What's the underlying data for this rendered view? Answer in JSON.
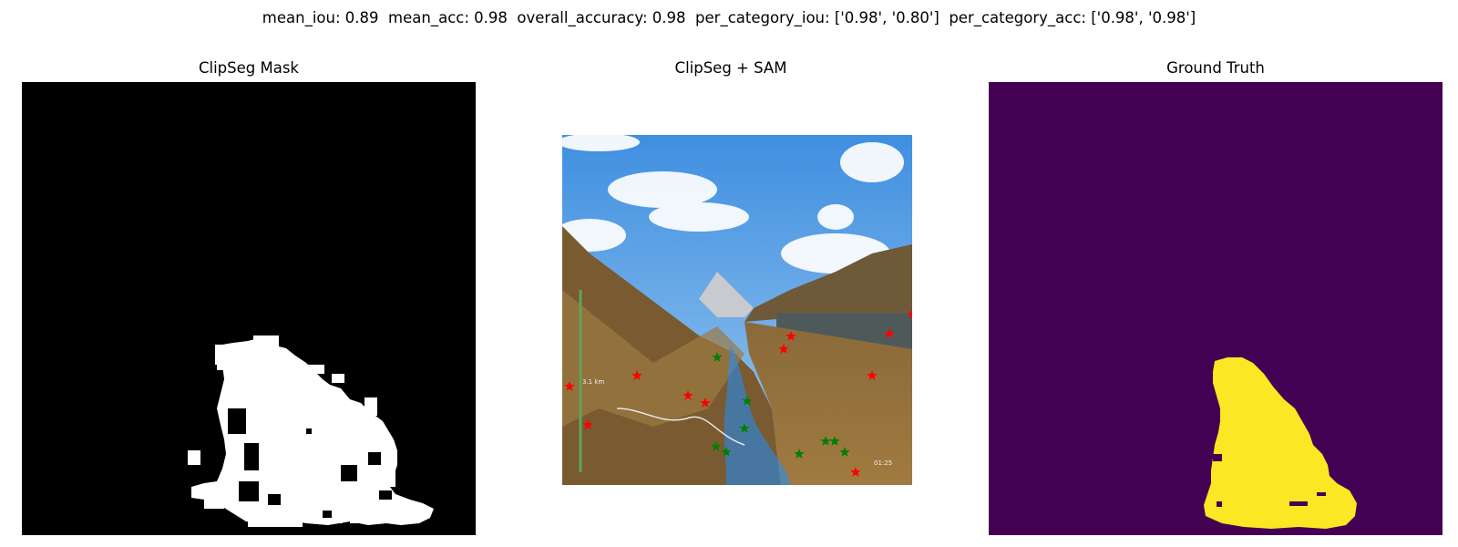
{
  "metrics": {
    "mean_iou_label": "mean_iou:",
    "mean_iou": "0.89",
    "mean_acc_label": "mean_acc:",
    "mean_acc": "0.98",
    "overall_accuracy_label": "overall_accuracy:",
    "overall_accuracy": "0.98",
    "per_category_iou_label": "per_category_iou:",
    "per_category_iou": "['0.98', '0.80']",
    "per_category_acc_label": "per_category_acc:",
    "per_category_acc": "['0.98', '0.98']"
  },
  "panels": {
    "left_title": "ClipSeg Mask",
    "middle_title": "ClipSeg + SAM",
    "right_title": "Ground Truth"
  },
  "photo_overlay": {
    "distance_label": "3.1 km",
    "corner_label": "01:25"
  },
  "colors": {
    "mask_background": "#000000",
    "mask_foreground": "#ffffff",
    "gt_background": "#440154",
    "gt_foreground": "#fde725",
    "sam_mask_overlay": "#1e90ff",
    "positive_point": "#008000",
    "negative_point": "#ff0000"
  },
  "icons": {
    "positive_point": "star-icon",
    "negative_point": "star-icon"
  }
}
